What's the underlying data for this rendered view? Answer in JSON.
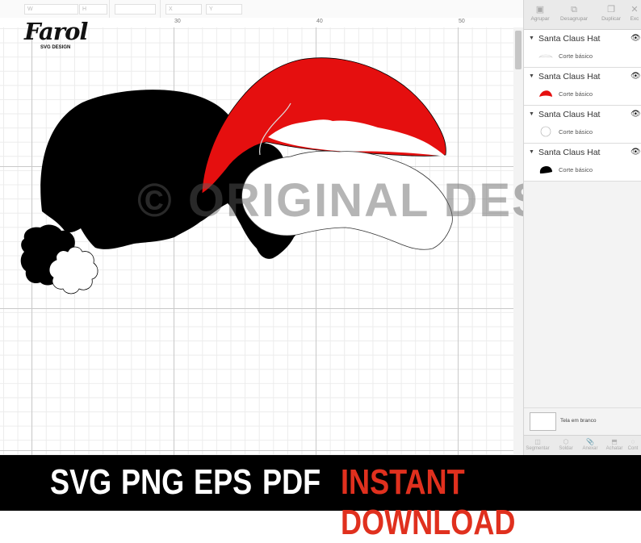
{
  "toolbar": {
    "fields": [
      "",
      "",
      "",
      ""
    ],
    "width_label": "W",
    "height_label": "H",
    "x_label": "X",
    "y_label": "Y"
  },
  "ruler": {
    "ticks": [
      "30",
      "40",
      "50"
    ]
  },
  "logo": {
    "main": "Farol",
    "sub": "SVG DESIGN"
  },
  "watermark": "© ORIGINAL DESIGN",
  "panel": {
    "top_tools": [
      "Agrupar",
      "Desagrupar",
      "Duplicar",
      "Exc"
    ],
    "layers": [
      {
        "title": "Santa Claus Hat",
        "sub": "Corte básico",
        "swatch": "white-brim"
      },
      {
        "title": "Santa Claus Hat",
        "sub": "Corte básico",
        "swatch": "red-hat"
      },
      {
        "title": "Santa Claus Hat",
        "sub": "Corte básico",
        "swatch": "white-ball"
      },
      {
        "title": "Santa Claus Hat",
        "sub": "Corte básico",
        "swatch": "black-hat"
      }
    ],
    "blank_canvas_label": "Tela em branco",
    "bottom_tools": [
      "Segmentar",
      "Soldar",
      "Anexar",
      "Achatar",
      "Cont"
    ]
  },
  "banner": {
    "formats": [
      "SVG",
      "PNG",
      "EPS",
      "PDF"
    ],
    "cta": "INSTANT DOWNLOAD"
  },
  "colors": {
    "red": "#e50f0f",
    "black": "#000000",
    "accent_orange": "#e0301e"
  }
}
